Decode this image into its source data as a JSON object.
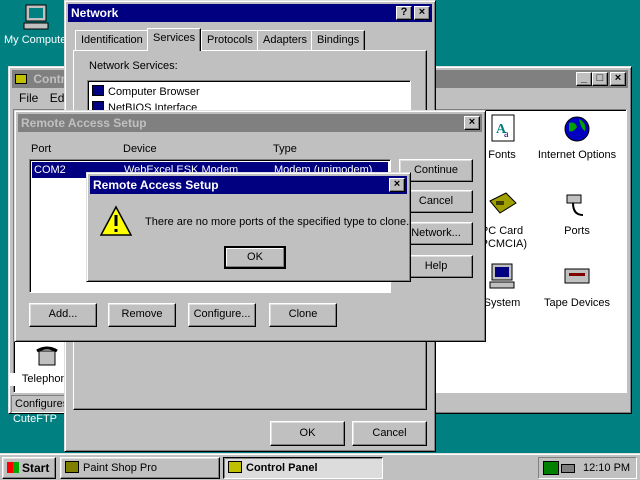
{
  "desktop": {
    "icons": [
      {
        "label": "My Computer"
      },
      {
        "label": "CuteFTP"
      }
    ]
  },
  "control_panel": {
    "title": "Control Panel",
    "menu": [
      "File",
      "Edit"
    ],
    "icons": [
      {
        "label": "Fonts",
        "icon": "fonts-icon"
      },
      {
        "label": "Internet Options",
        "icon": "internet-icon"
      },
      {
        "label": "PC Card (PCMCIA)",
        "icon": "pc-card-icon"
      },
      {
        "label": "Ports",
        "icon": "ports-icon"
      },
      {
        "label": "System",
        "icon": "system-icon"
      },
      {
        "label": "Tape Devices",
        "icon": "tape-icon"
      },
      {
        "label": "Telephony",
        "icon": "telephony-icon"
      }
    ],
    "status": "Configures"
  },
  "network": {
    "title": "Network",
    "tabs": [
      "Identification",
      "Services",
      "Protocols",
      "Adapters",
      "Bindings"
    ],
    "active_tab": "Services",
    "services_label": "Network Services:",
    "services": [
      "Computer Browser",
      "NetBIOS Interface"
    ],
    "ok_label": "OK",
    "cancel_label": "Cancel"
  },
  "ras": {
    "title": "Remote Access Setup",
    "columns": [
      "Port",
      "Device",
      "Type"
    ],
    "rows": [
      {
        "port": "COM2",
        "device": "WebExcel ESK Modem",
        "type": "Modem (unimodem)"
      }
    ],
    "buttons": {
      "continue": "Continue",
      "cancel": "Cancel",
      "network": "Network...",
      "help": "Help",
      "add": "Add...",
      "remove": "Remove",
      "configure": "Configure...",
      "clone": "Clone"
    }
  },
  "msgbox": {
    "title": "Remote Access Setup",
    "message": "There are no more ports of the specified type to clone.",
    "ok_label": "OK"
  },
  "taskbar": {
    "start_label": "Start",
    "tasks": [
      {
        "label": "Paint Shop Pro",
        "active": false
      },
      {
        "label": "Control Panel",
        "active": true
      }
    ],
    "clock": "12:10 PM"
  }
}
